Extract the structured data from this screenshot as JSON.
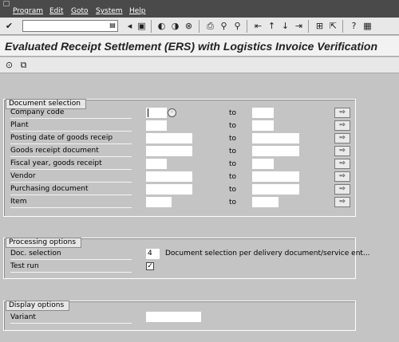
{
  "menubar": {
    "items": [
      {
        "label": "Program"
      },
      {
        "label": "Edit"
      },
      {
        "label": "Goto"
      },
      {
        "label": "System"
      },
      {
        "label": "Help"
      }
    ]
  },
  "toolbar": {
    "command_field_value": "",
    "icons": [
      "checkmark-icon",
      "save-icon",
      "back-icon",
      "exit-icon",
      "cancel-icon",
      "print-icon",
      "find-icon",
      "find-next-icon",
      "first-page-icon",
      "previous-page-icon",
      "next-page-icon",
      "last-page-icon",
      "new-session-icon",
      "shortcut-icon",
      "help-icon",
      "layout-icon"
    ]
  },
  "title": "Evaluated Receipt Settlement (ERS) with Logistics Invoice Verification",
  "app_toolbar": {
    "icons": [
      "execute-icon",
      "variants-icon"
    ]
  },
  "document_selection": {
    "title": "Document selection",
    "to_label": "to",
    "rows": [
      {
        "label": "Company code",
        "from": "",
        "to": ""
      },
      {
        "label": "Plant",
        "from": "",
        "to": ""
      },
      {
        "label": "Posting date of goods receip",
        "from": "",
        "to": ""
      },
      {
        "label": "Goods receipt document",
        "from": "",
        "to": ""
      },
      {
        "label": "Fiscal year, goods receipt",
        "from": "",
        "to": ""
      },
      {
        "label": "Vendor",
        "from": "",
        "to": ""
      },
      {
        "label": "Purchasing document",
        "from": "",
        "to": ""
      },
      {
        "label": "Item",
        "from": "",
        "to": ""
      }
    ]
  },
  "processing_options": {
    "title": "Processing options",
    "doc_selection_label": "Doc. selection",
    "doc_selection_value": "4",
    "doc_selection_desc": "Document selection per delivery document/service ent...",
    "test_run_label": "Test run",
    "test_run_checked": true
  },
  "display_options": {
    "title": "Display options",
    "variant_label": "Variant",
    "variant_value": ""
  }
}
